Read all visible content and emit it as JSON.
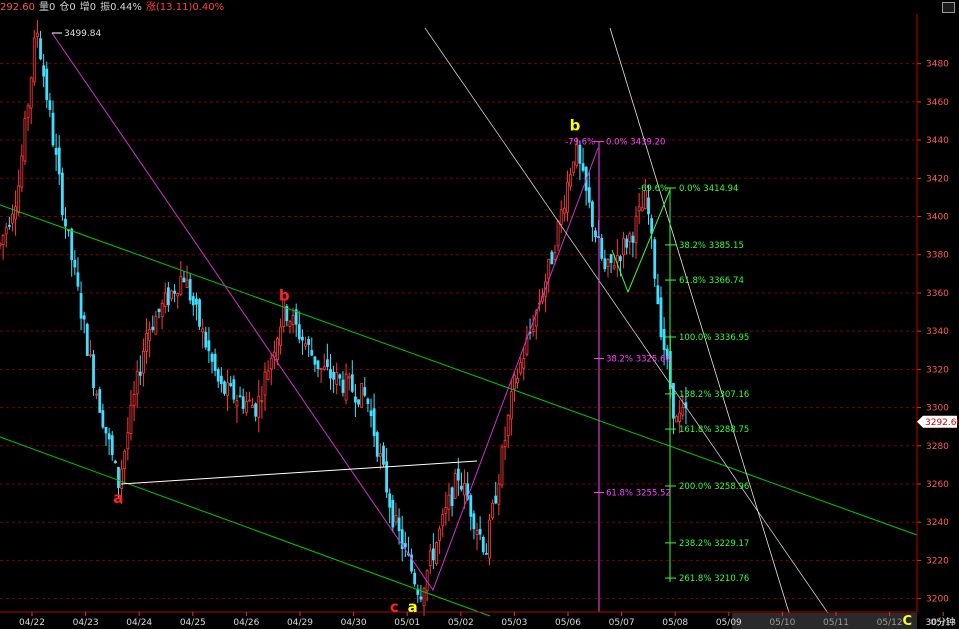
{
  "header": {
    "price": "292.60",
    "volume": "量0",
    "position": "仓0",
    "increase": "增0",
    "amplitude": "振0.44%",
    "change": "涨(13.11)0.40%"
  },
  "footer": {
    "period": "30分钟",
    "wave_corner": "C"
  },
  "colors": {
    "background": "#000000",
    "up_candle": "#ff3a3a",
    "down_candle": "#3fdfff",
    "grid": "#7a0000",
    "channel": "#00c800",
    "wave_line": "#cc33cc",
    "fib_green": "#33ff33",
    "fib_magenta": "#ff44ff",
    "wave_red": "#ff2020",
    "wave_yellow": "#ffff00",
    "current_price_bg": "#ffffff"
  },
  "chart_data": {
    "type": "candlestick",
    "x_labels": [
      "04/22",
      "04/23",
      "04/24",
      "04/25",
      "04/26",
      "04/29",
      "04/30",
      "05/01",
      "05/02",
      "05/03",
      "05/06",
      "05/07",
      "05/08",
      "05/09",
      "05/10",
      "05/11",
      "05/12",
      "05/13"
    ],
    "y_ticks": [
      3200,
      3220,
      3240,
      3260,
      3280,
      3300,
      3320,
      3340,
      3360,
      3380,
      3400,
      3420,
      3440,
      3460,
      3480
    ],
    "ylim": [
      3193,
      3506
    ],
    "grid": true,
    "current_price": "3292.60",
    "high_label": "3499.84",
    "trend_points": [
      {
        "x": 0,
        "y": 3385
      },
      {
        "x": 0.02,
        "y": 3415
      },
      {
        "x": 0.04,
        "y": 3499.84
      },
      {
        "x": 0.07,
        "y": 3400
      },
      {
        "x": 0.1,
        "y": 3320
      },
      {
        "x": 0.129,
        "y": 3260
      },
      {
        "x": 0.16,
        "y": 3340
      },
      {
        "x": 0.2,
        "y": 3370
      },
      {
        "x": 0.24,
        "y": 3310
      },
      {
        "x": 0.28,
        "y": 3300
      },
      {
        "x": 0.31,
        "y": 3352
      },
      {
        "x": 0.35,
        "y": 3320
      },
      {
        "x": 0.4,
        "y": 3305
      },
      {
        "x": 0.43,
        "y": 3240
      },
      {
        "x": 0.458,
        "y": 3203
      },
      {
        "x": 0.5,
        "y": 3265
      },
      {
        "x": 0.53,
        "y": 3225
      },
      {
        "x": 0.56,
        "y": 3310
      },
      {
        "x": 0.6,
        "y": 3375
      },
      {
        "x": 0.627,
        "y": 3436
      },
      {
        "x": 0.66,
        "y": 3370
      },
      {
        "x": 0.69,
        "y": 3392
      },
      {
        "x": 0.705,
        "y": 3410
      },
      {
        "x": 0.72,
        "y": 3345
      },
      {
        "x": 0.737,
        "y": 3292
      },
      {
        "x": 0.75,
        "y": 3298
      }
    ],
    "annotations": {
      "fib_green": [
        {
          "pct": "-69.6%",
          "label": "0.0% 3414.94",
          "price": 3414.94
        },
        {
          "pct": "",
          "label": "38.2% 3385.15",
          "price": 3385.15
        },
        {
          "pct": "",
          "label": "61.8% 3366.74",
          "price": 3366.74
        },
        {
          "pct": "",
          "label": "100.0% 3336.95",
          "price": 3336.95
        },
        {
          "pct": "",
          "label": "138.2% 3307.16",
          "price": 3307.16
        },
        {
          "pct": "",
          "label": "161.8% 3288.75",
          "price": 3288.75
        },
        {
          "pct": "",
          "label": "200.0% 3258.96",
          "price": 3258.96
        },
        {
          "pct": "",
          "label": "238.2% 3229.17",
          "price": 3229.17
        },
        {
          "pct": "",
          "label": "261.8% 3210.76",
          "price": 3210.76
        }
      ],
      "fib_magenta": [
        {
          "pct": "-79.6%",
          "label": "0.0% 3439.20",
          "price": 3439.2
        },
        {
          "pct": "",
          "label": "38.2% 3325.66",
          "price": 3325.66
        },
        {
          "pct": "",
          "label": "61.8% 3255.52",
          "price": 3255.52
        }
      ],
      "wave_labels": [
        {
          "text": "a",
          "color": "red",
          "price": 3250,
          "slot": 0.129
        },
        {
          "text": "b",
          "color": "red",
          "price": 3356,
          "slot": 0.31
        },
        {
          "text": "c",
          "color": "red",
          "price": 3193,
          "slot": 0.43
        },
        {
          "text": "a",
          "color": "yellow",
          "price": 3193,
          "slot": 0.45
        },
        {
          "text": "b",
          "color": "yellow",
          "price": 3445,
          "slot": 0.627
        }
      ]
    }
  }
}
